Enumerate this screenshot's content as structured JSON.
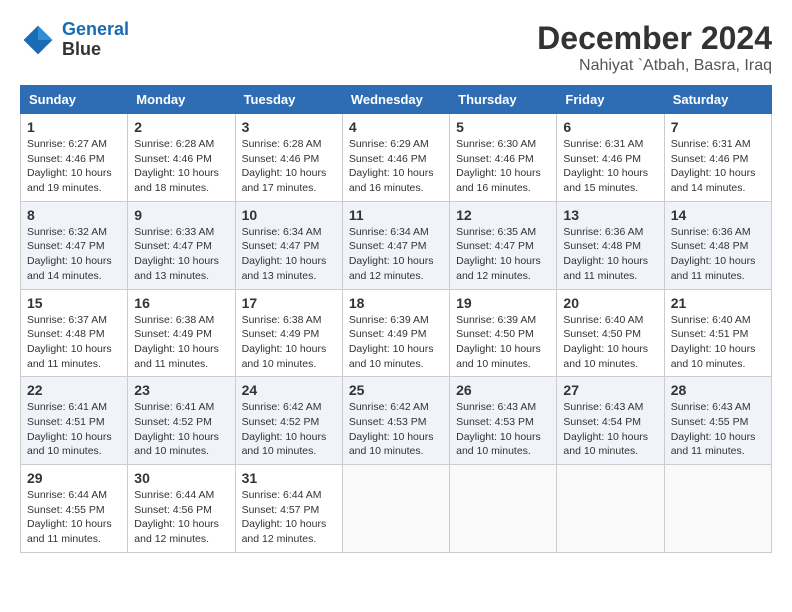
{
  "header": {
    "logo_line1": "General",
    "logo_line2": "Blue",
    "title": "December 2024",
    "subtitle": "Nahiyat `Atbah, Basra, Iraq"
  },
  "days_of_week": [
    "Sunday",
    "Monday",
    "Tuesday",
    "Wednesday",
    "Thursday",
    "Friday",
    "Saturday"
  ],
  "weeks": [
    [
      {
        "day": "1",
        "info": "Sunrise: 6:27 AM\nSunset: 4:46 PM\nDaylight: 10 hours and 19 minutes."
      },
      {
        "day": "2",
        "info": "Sunrise: 6:28 AM\nSunset: 4:46 PM\nDaylight: 10 hours and 18 minutes."
      },
      {
        "day": "3",
        "info": "Sunrise: 6:28 AM\nSunset: 4:46 PM\nDaylight: 10 hours and 17 minutes."
      },
      {
        "day": "4",
        "info": "Sunrise: 6:29 AM\nSunset: 4:46 PM\nDaylight: 10 hours and 16 minutes."
      },
      {
        "day": "5",
        "info": "Sunrise: 6:30 AM\nSunset: 4:46 PM\nDaylight: 10 hours and 16 minutes."
      },
      {
        "day": "6",
        "info": "Sunrise: 6:31 AM\nSunset: 4:46 PM\nDaylight: 10 hours and 15 minutes."
      },
      {
        "day": "7",
        "info": "Sunrise: 6:31 AM\nSunset: 4:46 PM\nDaylight: 10 hours and 14 minutes."
      }
    ],
    [
      {
        "day": "8",
        "info": "Sunrise: 6:32 AM\nSunset: 4:47 PM\nDaylight: 10 hours and 14 minutes."
      },
      {
        "day": "9",
        "info": "Sunrise: 6:33 AM\nSunset: 4:47 PM\nDaylight: 10 hours and 13 minutes."
      },
      {
        "day": "10",
        "info": "Sunrise: 6:34 AM\nSunset: 4:47 PM\nDaylight: 10 hours and 13 minutes."
      },
      {
        "day": "11",
        "info": "Sunrise: 6:34 AM\nSunset: 4:47 PM\nDaylight: 10 hours and 12 minutes."
      },
      {
        "day": "12",
        "info": "Sunrise: 6:35 AM\nSunset: 4:47 PM\nDaylight: 10 hours and 12 minutes."
      },
      {
        "day": "13",
        "info": "Sunrise: 6:36 AM\nSunset: 4:48 PM\nDaylight: 10 hours and 11 minutes."
      },
      {
        "day": "14",
        "info": "Sunrise: 6:36 AM\nSunset: 4:48 PM\nDaylight: 10 hours and 11 minutes."
      }
    ],
    [
      {
        "day": "15",
        "info": "Sunrise: 6:37 AM\nSunset: 4:48 PM\nDaylight: 10 hours and 11 minutes."
      },
      {
        "day": "16",
        "info": "Sunrise: 6:38 AM\nSunset: 4:49 PM\nDaylight: 10 hours and 11 minutes."
      },
      {
        "day": "17",
        "info": "Sunrise: 6:38 AM\nSunset: 4:49 PM\nDaylight: 10 hours and 10 minutes."
      },
      {
        "day": "18",
        "info": "Sunrise: 6:39 AM\nSunset: 4:49 PM\nDaylight: 10 hours and 10 minutes."
      },
      {
        "day": "19",
        "info": "Sunrise: 6:39 AM\nSunset: 4:50 PM\nDaylight: 10 hours and 10 minutes."
      },
      {
        "day": "20",
        "info": "Sunrise: 6:40 AM\nSunset: 4:50 PM\nDaylight: 10 hours and 10 minutes."
      },
      {
        "day": "21",
        "info": "Sunrise: 6:40 AM\nSunset: 4:51 PM\nDaylight: 10 hours and 10 minutes."
      }
    ],
    [
      {
        "day": "22",
        "info": "Sunrise: 6:41 AM\nSunset: 4:51 PM\nDaylight: 10 hours and 10 minutes."
      },
      {
        "day": "23",
        "info": "Sunrise: 6:41 AM\nSunset: 4:52 PM\nDaylight: 10 hours and 10 minutes."
      },
      {
        "day": "24",
        "info": "Sunrise: 6:42 AM\nSunset: 4:52 PM\nDaylight: 10 hours and 10 minutes."
      },
      {
        "day": "25",
        "info": "Sunrise: 6:42 AM\nSunset: 4:53 PM\nDaylight: 10 hours and 10 minutes."
      },
      {
        "day": "26",
        "info": "Sunrise: 6:43 AM\nSunset: 4:53 PM\nDaylight: 10 hours and 10 minutes."
      },
      {
        "day": "27",
        "info": "Sunrise: 6:43 AM\nSunset: 4:54 PM\nDaylight: 10 hours and 10 minutes."
      },
      {
        "day": "28",
        "info": "Sunrise: 6:43 AM\nSunset: 4:55 PM\nDaylight: 10 hours and 11 minutes."
      }
    ],
    [
      {
        "day": "29",
        "info": "Sunrise: 6:44 AM\nSunset: 4:55 PM\nDaylight: 10 hours and 11 minutes."
      },
      {
        "day": "30",
        "info": "Sunrise: 6:44 AM\nSunset: 4:56 PM\nDaylight: 10 hours and 12 minutes."
      },
      {
        "day": "31",
        "info": "Sunrise: 6:44 AM\nSunset: 4:57 PM\nDaylight: 10 hours and 12 minutes."
      },
      null,
      null,
      null,
      null
    ]
  ]
}
